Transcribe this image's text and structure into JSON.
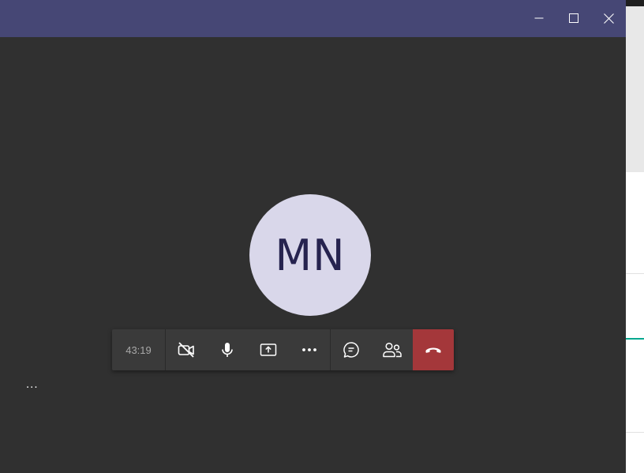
{
  "window": {
    "minimize_icon": "minimize-icon",
    "maximize_icon": "maximize-icon",
    "close_icon": "close-icon",
    "titlebar_color": "#464775"
  },
  "participant": {
    "initials": "MN",
    "avatar_bg": "#d9d7ea",
    "initials_color": "#26234f"
  },
  "call_controls": {
    "timer": "43:19",
    "buttons": [
      {
        "name": "camera-off",
        "icon": "camera-off-icon"
      },
      {
        "name": "microphone",
        "icon": "microphone-icon"
      },
      {
        "name": "share-screen",
        "icon": "share-screen-icon"
      },
      {
        "name": "more-actions",
        "icon": "more-icon"
      },
      {
        "name": "chat",
        "icon": "chat-icon"
      },
      {
        "name": "participants",
        "icon": "people-icon"
      },
      {
        "name": "hang-up",
        "icon": "hang-up-icon"
      }
    ],
    "hangup_color": "#a4373a"
  },
  "status": {
    "ellipsis": "..."
  }
}
